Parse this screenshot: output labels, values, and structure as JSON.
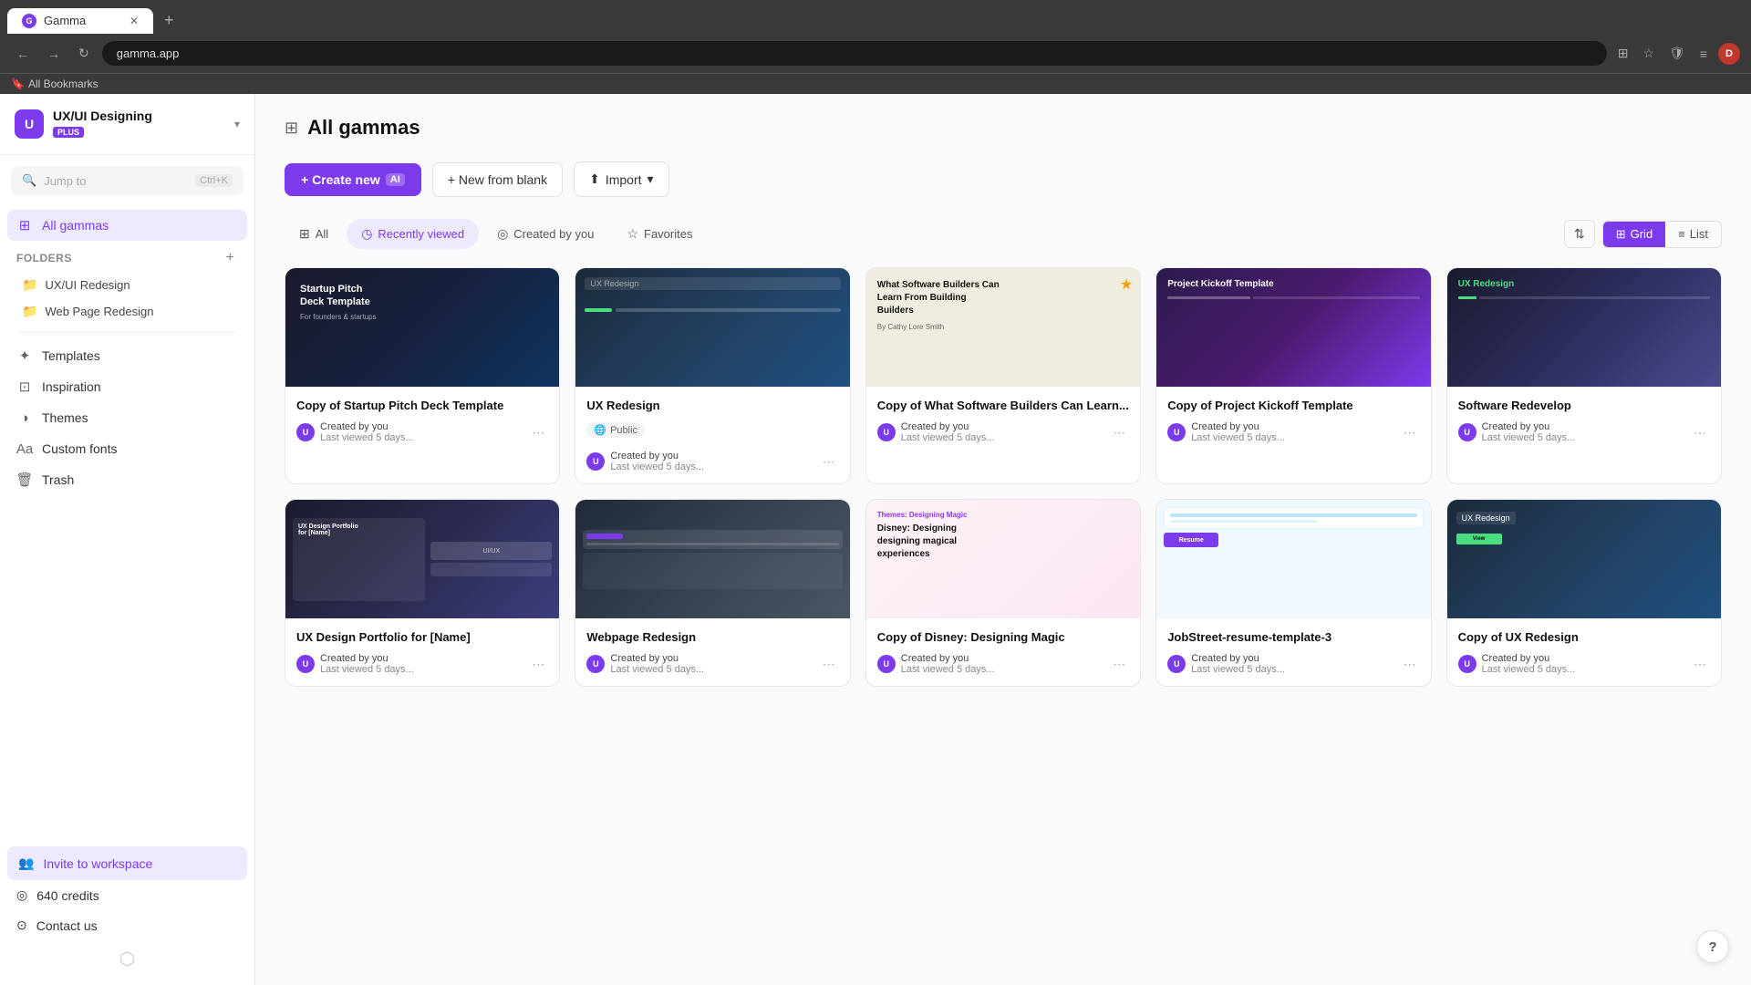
{
  "browser": {
    "tab_title": "Gamma",
    "tab_favicon": "G",
    "url": "gamma.app",
    "bookmarks_label": "All Bookmarks"
  },
  "sidebar": {
    "workspace_initial": "U",
    "workspace_name": "UX/UI Designing",
    "workspace_badge": "PLUS",
    "search_placeholder": "Jump to",
    "search_shortcut": "Ctrl+K",
    "nav_all_gammas": "All gammas",
    "folders_label": "Folders",
    "folders": [
      {
        "name": "UX/UI Redesign"
      },
      {
        "name": "Web Page Redesign"
      }
    ],
    "templates_label": "Templates",
    "inspiration_label": "Inspiration",
    "themes_label": "Themes",
    "custom_fonts_label": "Custom fonts",
    "trash_label": "Trash",
    "invite_label": "Invite to workspace",
    "credits_label": "640 credits",
    "contact_label": "Contact us"
  },
  "main": {
    "page_title": "All gammas",
    "btn_create": "+ Create new",
    "btn_create_ai": "AI",
    "btn_new_blank": "+ New from blank",
    "btn_import": "Import",
    "filter_all": "All",
    "filter_recently_viewed": "Recently viewed",
    "filter_created_by_you": "Created by you",
    "filter_favorites": "Favorites",
    "view_grid": "Grid",
    "view_list": "List",
    "cards": [
      {
        "title": "Copy of Startup Pitch Deck Template",
        "thumbnail_class": "thumbnail-1",
        "thumbnail_type": "startup",
        "public": false,
        "star": false,
        "created_by": "Created by you",
        "last_viewed": "Last viewed 5 days..."
      },
      {
        "title": "UX Redesign",
        "thumbnail_class": "thumbnail-2",
        "thumbnail_type": "ux",
        "public": true,
        "star": false,
        "created_by": "Created by you",
        "last_viewed": "Last viewed 5 days..."
      },
      {
        "title": "Copy of What Software Builders Can Learn...",
        "thumbnail_class": "thumbnail-3",
        "thumbnail_type": "what",
        "public": false,
        "star": true,
        "created_by": "Created by you",
        "last_viewed": "Last viewed 5 days..."
      },
      {
        "title": "Copy of Project Kickoff Template",
        "thumbnail_class": "thumbnail-4",
        "thumbnail_type": "project",
        "public": false,
        "star": false,
        "created_by": "Created by you",
        "last_viewed": "Last viewed 5 days..."
      },
      {
        "title": "Software Redevelop",
        "thumbnail_class": "thumbnail-5",
        "thumbnail_type": "ux2",
        "public": false,
        "star": false,
        "created_by": "Created by you",
        "last_viewed": "Last viewed 5 days..."
      },
      {
        "title": "UX Design Portfolio for [Name]",
        "thumbnail_class": "thumbnail-6",
        "thumbnail_type": "portfolio",
        "public": false,
        "star": false,
        "created_by": "Created by you",
        "last_viewed": "Last viewed 5 days..."
      },
      {
        "title": "Webpage Redesign",
        "thumbnail_class": "thumbnail-7",
        "thumbnail_type": "webpage",
        "public": false,
        "star": false,
        "created_by": "Created by you",
        "last_viewed": "Last viewed 5 days..."
      },
      {
        "title": "Copy of Disney: Designing Magic",
        "thumbnail_class": "thumbnail-8",
        "thumbnail_type": "disney",
        "public": false,
        "star": false,
        "created_by": "Created by you",
        "last_viewed": "Last viewed 5 days..."
      },
      {
        "title": "JobStreet-resume-template-3",
        "thumbnail_class": "thumbnail-9",
        "thumbnail_type": "job",
        "public": false,
        "star": false,
        "created_by": "Created by you",
        "last_viewed": "Last viewed 5 days..."
      },
      {
        "title": "Copy of UX Redesign",
        "thumbnail_class": "thumbnail-10",
        "thumbnail_type": "ux3",
        "public": false,
        "star": false,
        "created_by": "Created by you",
        "last_viewed": "Last viewed 5 days..."
      }
    ]
  },
  "help_btn": "?"
}
